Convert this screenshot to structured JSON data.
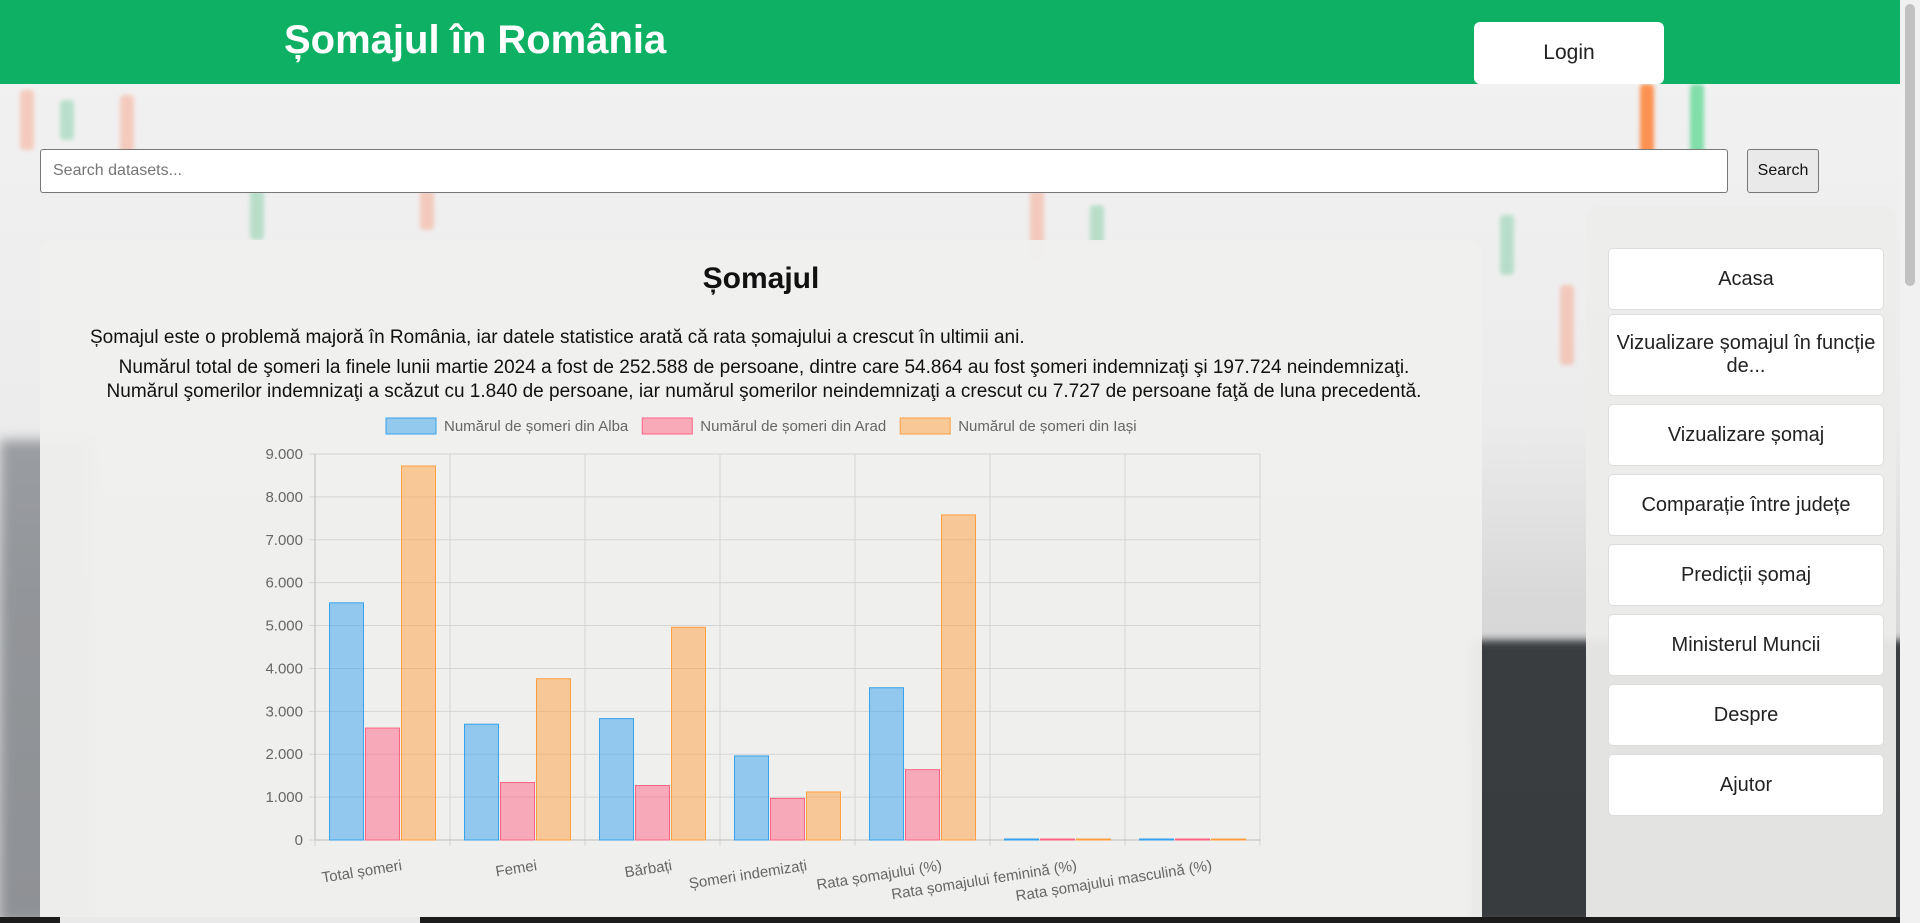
{
  "header": {
    "title": "Șomajul în România",
    "login_label": "Login"
  },
  "search": {
    "placeholder": "Search datasets...",
    "button_label": "Search"
  },
  "main": {
    "title": "Șomajul",
    "paragraph1": "Șomajul este o problemă majoră în România, iar datele statistice arată că rata șomajului a crescut în ultimii ani.",
    "paragraph2_line1": "Numărul total de şomeri la finele lunii martie 2024 a fost de 252.588 de persoane, dintre care 54.864 au fost şomeri indemnizaţi şi 197.724 neindemnizaţi.",
    "paragraph2_line2": "Numărul şomerilor indemnizaţi a scăzut cu 1.840 de persoane, iar numărul şomerilor neindemnizaţi a crescut cu 7.727 de persoane faţă de luna precedentă."
  },
  "sidebar": {
    "items": [
      {
        "label": "Acasa"
      },
      {
        "label": "Vizualizare șomajul în funcție de..."
      },
      {
        "label": "Vizualizare șomaj"
      },
      {
        "label": "Comparație între județe"
      },
      {
        "label": "Predicții șomaj"
      },
      {
        "label": "Ministerul Muncii"
      },
      {
        "label": "Despre"
      },
      {
        "label": "Ajutor"
      }
    ]
  },
  "chart_data": {
    "type": "bar",
    "categories": [
      "Total șomeri",
      "Femei",
      "Bărbați",
      "Șomeri indemizați",
      "Rata șomajului (%)",
      "Rata șomajului feminină (%)",
      "Rata șomajului masculină (%)"
    ],
    "series": [
      {
        "name": "Numărul de șomeri din Alba",
        "color": "#36a2eb",
        "values": [
          5530,
          2700,
          2830,
          1960,
          3550,
          4,
          4
        ]
      },
      {
        "name": "Numărul de șomeri din Arad",
        "color": "#ff6384",
        "values": [
          2610,
          1340,
          1270,
          970,
          1640,
          2,
          2
        ]
      },
      {
        "name": "Numărul de șomeri din Iași",
        "color": "#ff9f40",
        "values": [
          8720,
          3760,
          4960,
          1120,
          7580,
          6,
          6
        ]
      }
    ],
    "y_ticks": [
      "0",
      "1.000",
      "2.000",
      "3.000",
      "4.000",
      "5.000",
      "6.000",
      "7.000",
      "8.000",
      "9.000"
    ],
    "ylim": [
      0,
      9000
    ],
    "grid": true,
    "legend_position": "top"
  }
}
